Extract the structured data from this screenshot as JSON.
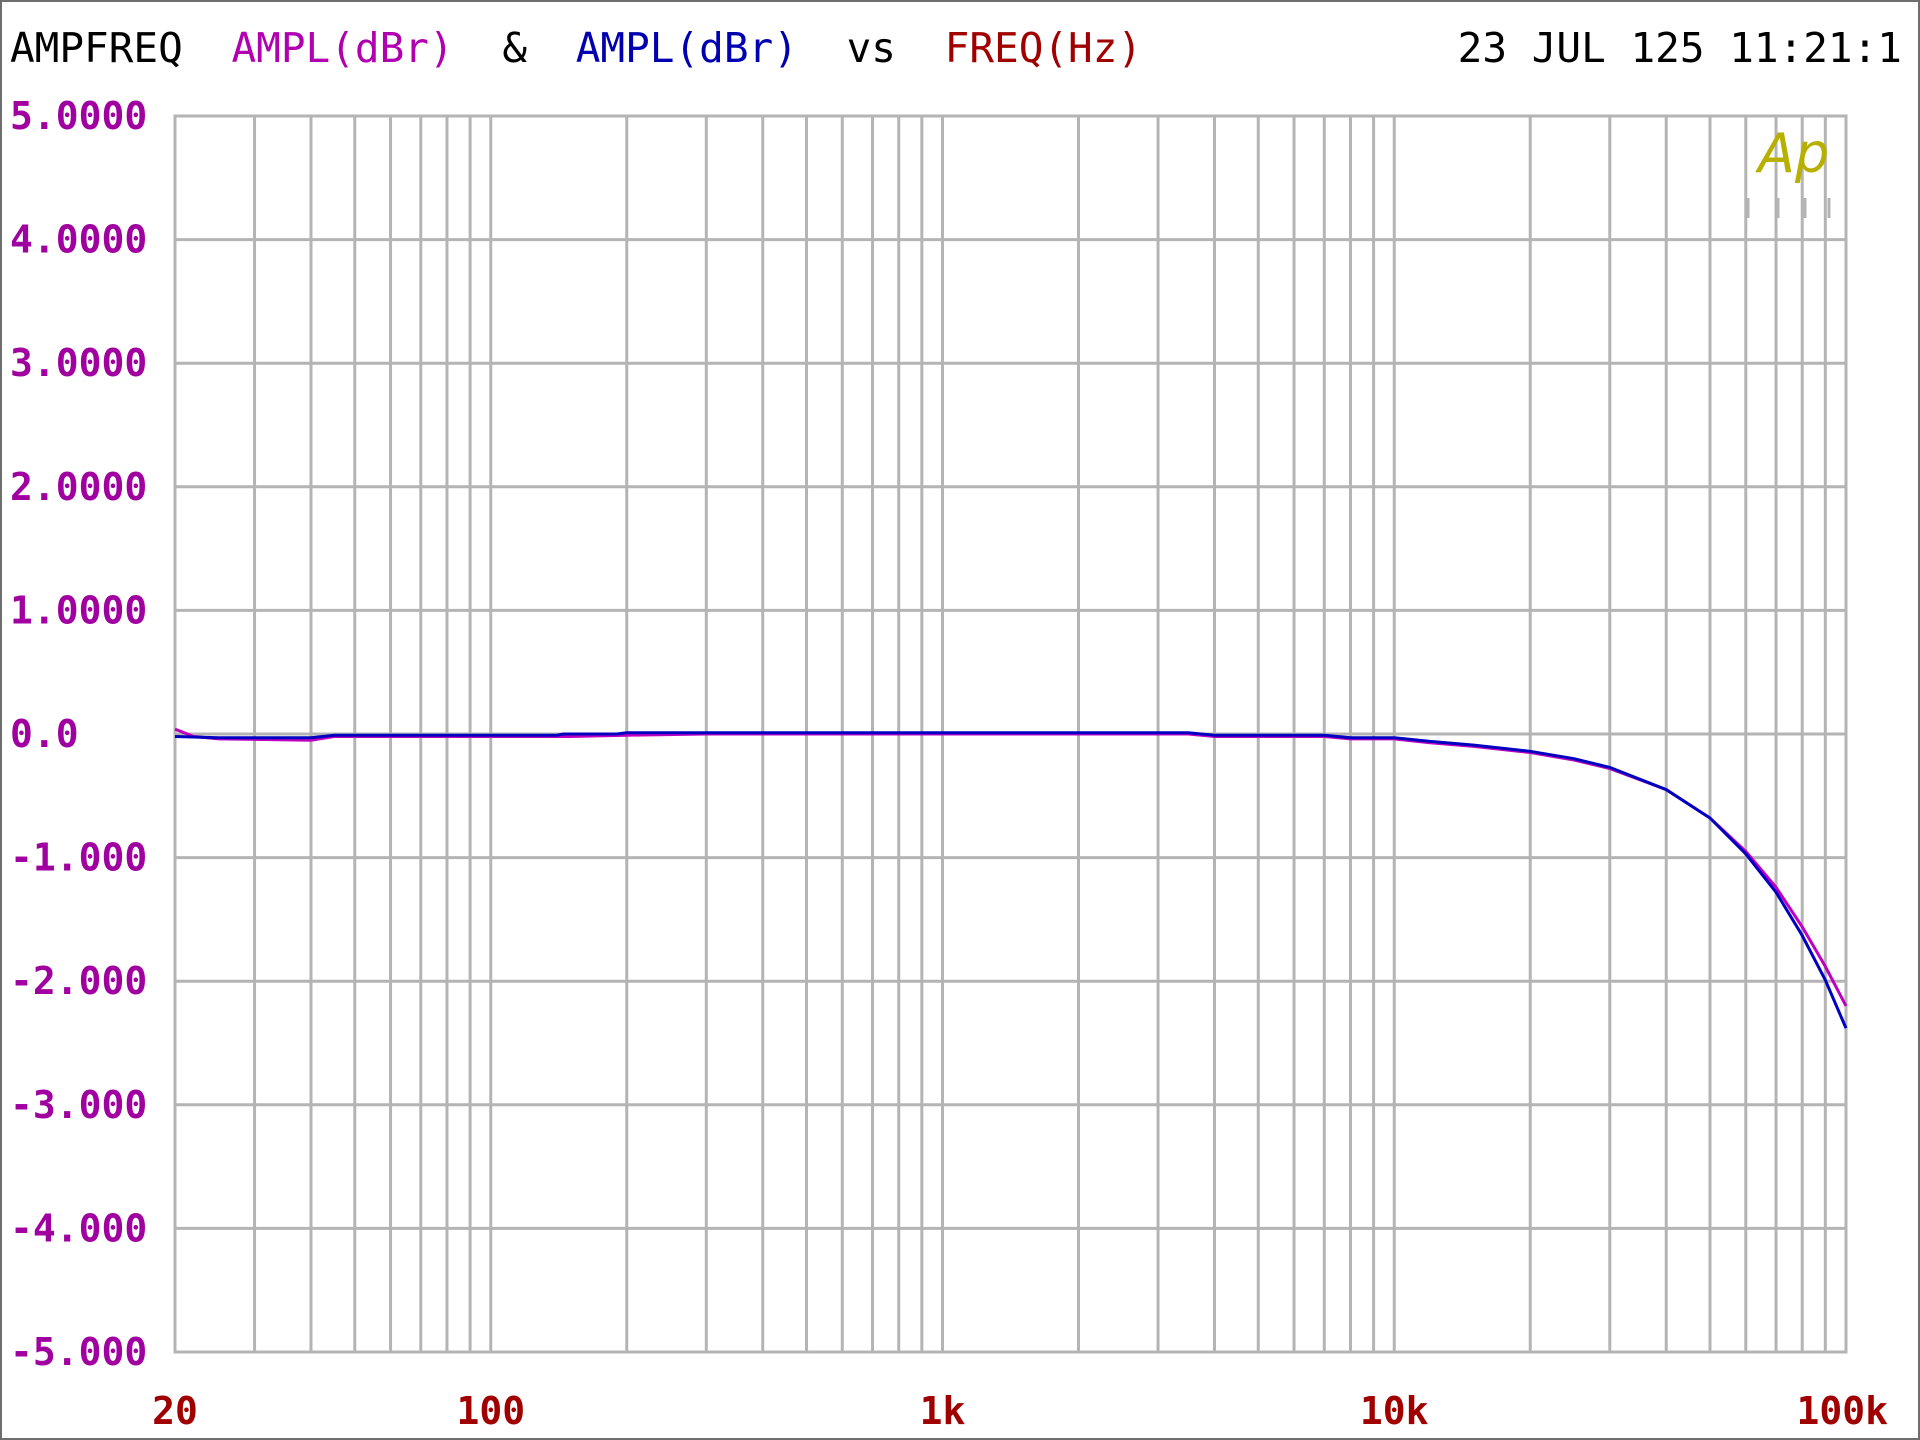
{
  "header": {
    "title_parts": [
      {
        "text": "AMPFREQ",
        "color": "#000000"
      },
      {
        "text": "AMPL(dBr)",
        "color": "#b000b0"
      },
      {
        "text": "&",
        "color": "#000000"
      },
      {
        "text": "AMPL(dBr)",
        "color": "#0000b0"
      },
      {
        "text": "vs",
        "color": "#000000"
      },
      {
        "text": "FREQ(Hz)",
        "color": "#a00000"
      }
    ],
    "timestamp": "23 JUL 125 11:21:1"
  },
  "logo": {
    "text": "Ap",
    "color": "#b8b000"
  },
  "colors": {
    "grid": "#b4b4b4",
    "y_ticks": "#a000a0",
    "x_ticks": "#a00000"
  },
  "chart_data": {
    "type": "line",
    "x_scale": "log",
    "xlim": [
      20,
      100000
    ],
    "ylim": [
      -5,
      5
    ],
    "grid": true,
    "xlabel": "FREQ(Hz)",
    "ylabel": "AMPL(dBr)",
    "x_ticks": [
      {
        "value": 20,
        "label": "20"
      },
      {
        "value": 100,
        "label": "100"
      },
      {
        "value": 1000,
        "label": "1k"
      },
      {
        "value": 10000,
        "label": "10k"
      },
      {
        "value": 100000,
        "label": "100k"
      }
    ],
    "y_ticks": [
      {
        "value": 5,
        "label": "5.0000"
      },
      {
        "value": 4,
        "label": "4.0000"
      },
      {
        "value": 3,
        "label": "3.0000"
      },
      {
        "value": 2,
        "label": "2.0000"
      },
      {
        "value": 1,
        "label": "1.0000"
      },
      {
        "value": 0,
        "label": "0.0"
      },
      {
        "value": -1,
        "label": "-1.000"
      },
      {
        "value": -2,
        "label": "-2.000"
      },
      {
        "value": -3,
        "label": "-3.000"
      },
      {
        "value": -4,
        "label": "-4.000"
      },
      {
        "value": -5,
        "label": "-5.000"
      }
    ],
    "series": [
      {
        "color": "#c000c0",
        "points": [
          [
            20,
            0.04
          ],
          [
            22,
            -0.02
          ],
          [
            25,
            -0.04
          ],
          [
            40,
            -0.05
          ],
          [
            45,
            -0.02
          ],
          [
            100,
            -0.02
          ],
          [
            150,
            -0.02
          ],
          [
            200,
            -0.01
          ],
          [
            300,
            0.0
          ],
          [
            1000,
            0.0
          ],
          [
            3500,
            0.0
          ],
          [
            4000,
            -0.02
          ],
          [
            7000,
            -0.02
          ],
          [
            8000,
            -0.04
          ],
          [
            10000,
            -0.04
          ],
          [
            12000,
            -0.07
          ],
          [
            15000,
            -0.1
          ],
          [
            20000,
            -0.15
          ],
          [
            25000,
            -0.21
          ],
          [
            30000,
            -0.28
          ],
          [
            40000,
            -0.45
          ],
          [
            50000,
            -0.68
          ],
          [
            60000,
            -0.95
          ],
          [
            70000,
            -1.24
          ],
          [
            80000,
            -1.56
          ],
          [
            90000,
            -1.88
          ],
          [
            100000,
            -2.2
          ]
        ]
      },
      {
        "color": "#0000c0",
        "points": [
          [
            20,
            -0.02
          ],
          [
            25,
            -0.03
          ],
          [
            30,
            -0.03
          ],
          [
            40,
            -0.03
          ],
          [
            45,
            -0.01
          ],
          [
            100,
            -0.01
          ],
          [
            140,
            -0.01
          ],
          [
            145,
            0.0
          ],
          [
            190,
            0.0
          ],
          [
            200,
            0.01
          ],
          [
            1000,
            0.01
          ],
          [
            3500,
            0.01
          ],
          [
            4000,
            -0.01
          ],
          [
            7000,
            -0.01
          ],
          [
            8000,
            -0.03
          ],
          [
            10000,
            -0.03
          ],
          [
            12000,
            -0.06
          ],
          [
            15000,
            -0.09
          ],
          [
            20000,
            -0.14
          ],
          [
            25000,
            -0.2
          ],
          [
            30000,
            -0.27
          ],
          [
            40000,
            -0.45
          ],
          [
            50000,
            -0.68
          ],
          [
            60000,
            -0.97
          ],
          [
            70000,
            -1.28
          ],
          [
            80000,
            -1.63
          ],
          [
            90000,
            -1.99
          ],
          [
            100000,
            -2.38
          ]
        ]
      }
    ]
  }
}
